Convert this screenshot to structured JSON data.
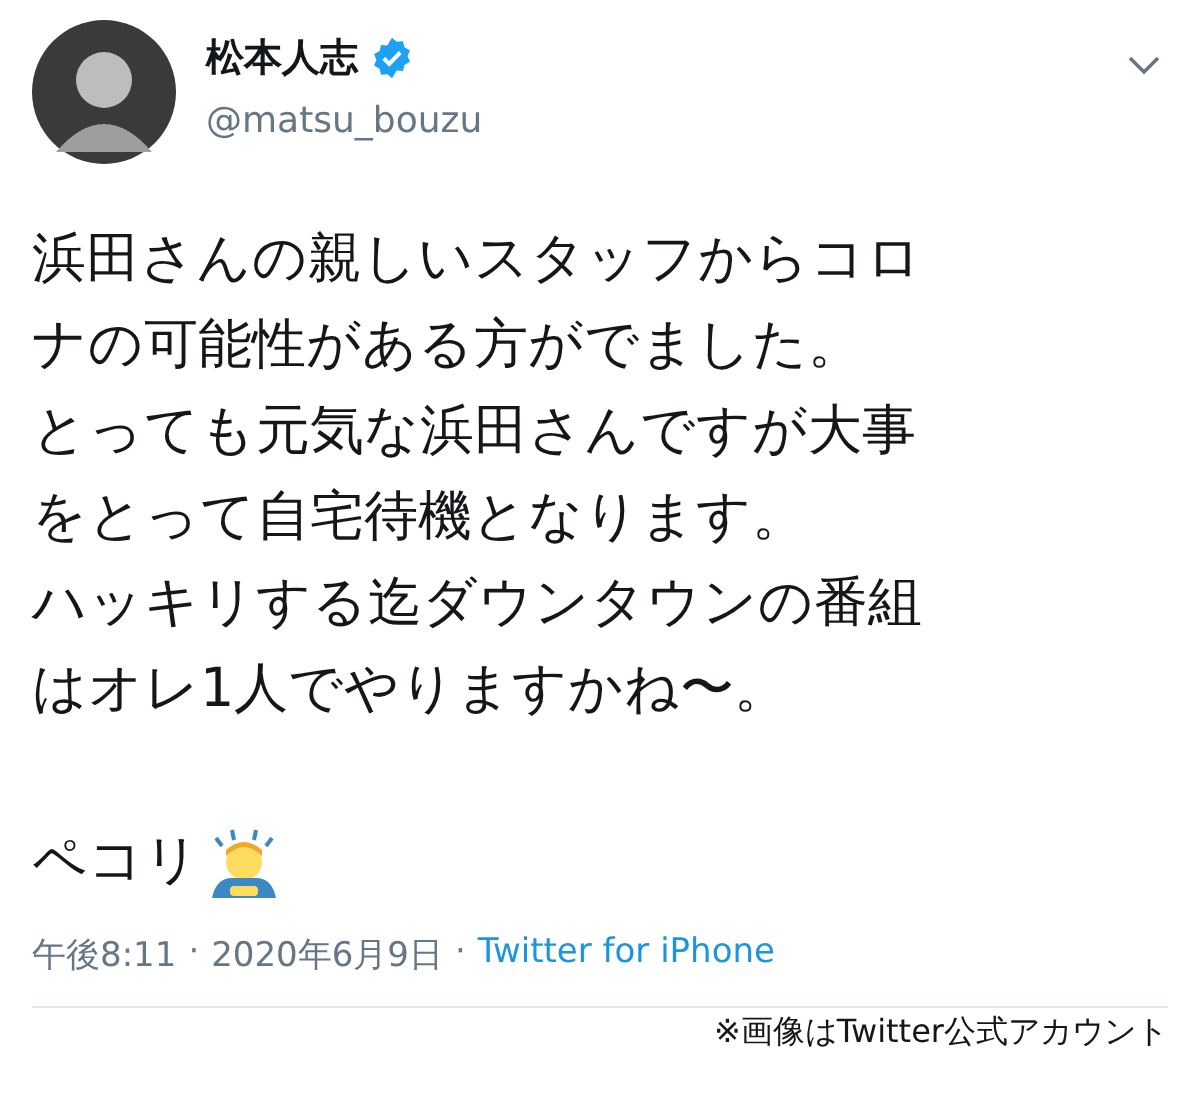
{
  "author": {
    "name": "松本人志",
    "verified": true,
    "handle": "@matsu_bouzu"
  },
  "body_lines": [
    "浜田さんの親しいスタッフからコロ",
    "ナの可能性がある方がでました。",
    "とっても元気な浜田さんですが大事",
    "をとって自宅待機となります。",
    "ハッキリする迄ダウンタウンの番組",
    "はオレ1人でやりますかね〜。"
  ],
  "closing": "ペコリ",
  "meta": {
    "time": "午後8:11",
    "separator_1": "·",
    "date": "2020年6月9日",
    "separator_2": "·",
    "source": "Twitter for iPhone"
  },
  "caption": "※画像はTwitter公式アカウント"
}
